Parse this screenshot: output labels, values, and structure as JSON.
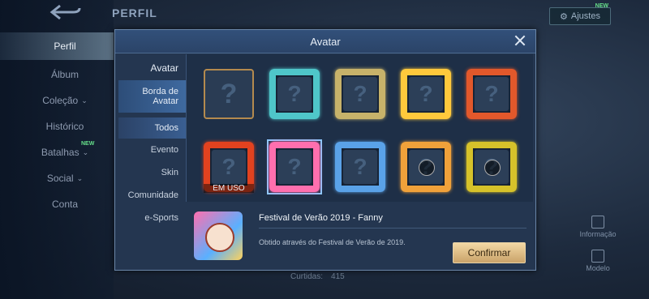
{
  "background": {
    "page_title": "PERFIL",
    "settings": {
      "label": "Ajustes",
      "new_badge": "NEW"
    },
    "side_menu": [
      {
        "label": "Perfil",
        "active": true
      },
      {
        "label": "Álbum"
      },
      {
        "label": "Coleção",
        "chevron": "⌄"
      },
      {
        "label": "Histórico"
      },
      {
        "label": "Batalhas",
        "chevron": "⌄",
        "new_badge": "NEW"
      },
      {
        "label": "Social",
        "chevron": "⌄"
      },
      {
        "label": "Conta"
      }
    ],
    "tools": [
      {
        "label": "Informação",
        "icon": "info-book-icon"
      },
      {
        "label": "Modelo",
        "icon": "cube-icon"
      }
    ],
    "likes": {
      "label": "Curtidas:",
      "value": "415"
    }
  },
  "modal": {
    "title": "Avatar",
    "tabs": {
      "avatar": "Avatar",
      "border": "Borda de Avatar",
      "todos": "Todos",
      "evento": "Evento",
      "skin": "Skin",
      "comunidade": "Comunidade",
      "esports": "e-Sports"
    },
    "frames": [
      {
        "state": "empty",
        "glyph": "?"
      },
      {
        "glyph": "?",
        "color": "#4fc6c9"
      },
      {
        "glyph": "?",
        "color": "#c7b26a"
      },
      {
        "glyph": "?",
        "color": "#ffc93c"
      },
      {
        "glyph": "?",
        "color": "#e2582b"
      },
      {
        "glyph": "?",
        "color": "#e2421f",
        "in_use": "EM USO"
      },
      {
        "glyph": "?",
        "color": "#ff6fae",
        "selected": true
      },
      {
        "glyph": "?",
        "color": "#5aa2e8"
      },
      {
        "glyph": "?",
        "color": "#f0a13a",
        "locked": true
      },
      {
        "glyph": "?",
        "color": "#d6c22a",
        "locked": true
      }
    ],
    "info": {
      "name": "Festival de Verão 2019 - Fanny",
      "description": "Obtido através do Festival de Verão de 2019.",
      "confirm_label": "Confirmar"
    }
  }
}
